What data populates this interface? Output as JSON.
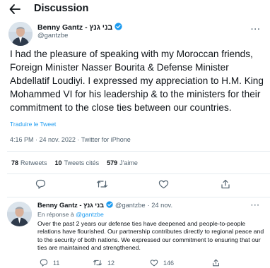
{
  "header": {
    "title": "Discussion"
  },
  "tweet": {
    "author_name": "Benny Gantz - בני גנץ",
    "handle": "@gantzbe",
    "text": "I had the pleasure of speaking with my Moroccan friends, Foreign Minister Nasser Bourita & Defense Minister Abdellatif Loudiyi. I expressed my appreciation to H.M. King Mohammed VI for his leadership & to the ministers for their commitment to the close ties between our countries.",
    "translate_label": "Traduire le Tweet",
    "timestamp": "4:16 PM · 24 nov. 2022 · Twitter for iPhone",
    "stats": {
      "retweets_count": "78",
      "retweets_label": "Retweets",
      "quotes_count": "10",
      "quotes_label": "Tweets cités",
      "likes_count": "579",
      "likes_label": "J'aime"
    }
  },
  "reply": {
    "author_name": "Benny Gantz - בני גנץ",
    "handle": "@gantzbe",
    "date": "· 24 nov.",
    "replying_prefix": "En réponse à",
    "replying_to": "@gantzbe",
    "text": "Over the past 2 years our defense ties have deepened and people-to-people relations have flourished. Our partnership contributes directly to regional peace and to the security of both nations. We expressed our commitment to ensuring that our ties are maintained and strengthened.",
    "actions": {
      "reply_count": "11",
      "retweet_count": "12",
      "like_count": "146"
    }
  },
  "colors": {
    "accent": "#1d9bf0",
    "text_primary": "#0f1419",
    "text_secondary": "#536471",
    "divider": "#e6ecf0"
  },
  "icons": {
    "back": "back-arrow-icon",
    "verified": "verified-badge-icon",
    "more": "more-options-icon",
    "reply": "reply-icon",
    "retweet": "retweet-icon",
    "like": "heart-icon",
    "share": "share-icon"
  }
}
